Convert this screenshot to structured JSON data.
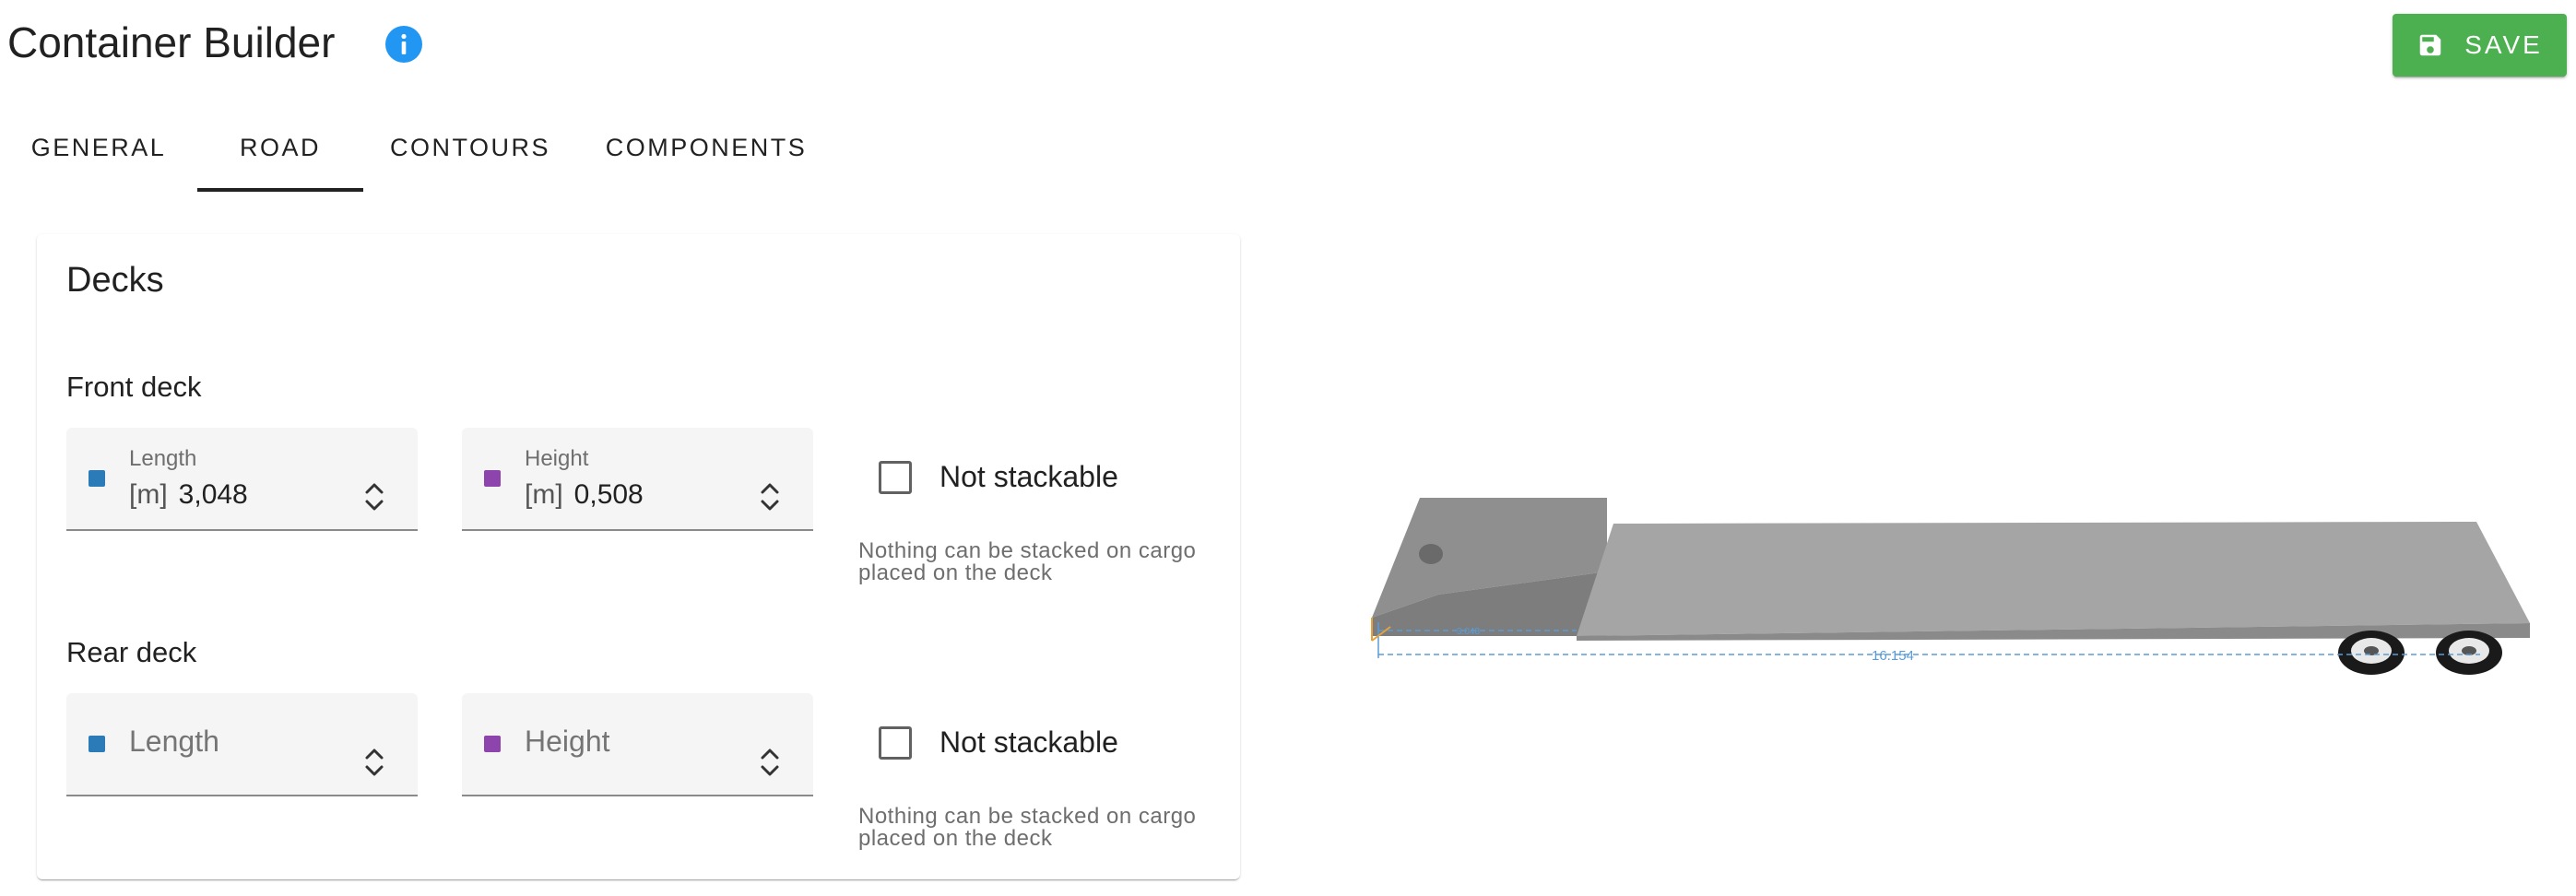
{
  "header": {
    "title": "Container Builder",
    "save_label": "SAVE",
    "save_color": "#4caf50",
    "info_color": "#2196f3"
  },
  "tabs": [
    {
      "label": "GENERAL",
      "active": false
    },
    {
      "label": "ROAD",
      "active": true
    },
    {
      "label": "CONTOURS",
      "active": false
    },
    {
      "label": "COMPONENTS",
      "active": false
    }
  ],
  "decks": {
    "title": "Decks",
    "front": {
      "label": "Front deck",
      "length": {
        "label": "Length",
        "unit": "[m]",
        "value": "3,048",
        "swatch_color": "#2b7bb9"
      },
      "height": {
        "label": "Height",
        "unit": "[m]",
        "value": "0,508",
        "swatch_color": "#8e44ad"
      },
      "not_stackable_label": "Not stackable",
      "not_stackable_checked": false,
      "helper_text": "Nothing can be stacked on cargo placed on the deck"
    },
    "rear": {
      "label": "Rear deck",
      "length": {
        "placeholder": "Length",
        "swatch_color": "#2b7bb9"
      },
      "height": {
        "placeholder": "Height",
        "swatch_color": "#8e44ad"
      },
      "not_stackable_label": "Not stackable",
      "not_stackable_checked": false,
      "helper_text": "Nothing can be stacked on cargo placed on the deck"
    }
  },
  "preview": {
    "front_length_label": "3.048",
    "total_length_label": "16.154",
    "deck_color": "#9e9e9e"
  }
}
